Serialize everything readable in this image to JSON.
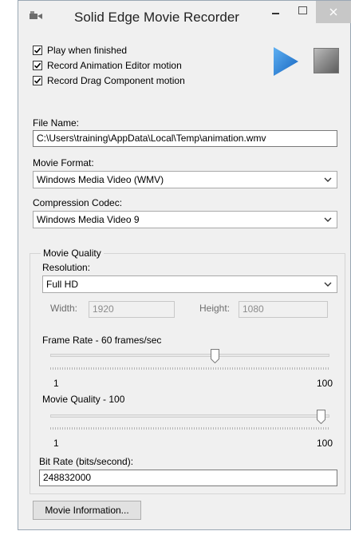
{
  "window": {
    "title": "Solid Edge Movie Recorder"
  },
  "options": {
    "play_when_finished": {
      "label": "Play when finished",
      "checked": true
    },
    "record_animation_editor": {
      "label": "Record Animation Editor motion",
      "checked": true
    },
    "record_drag_component": {
      "label": "Record Drag Component motion",
      "checked": true
    }
  },
  "file": {
    "label": "File Name:",
    "value": "C:\\Users\\training\\AppData\\Local\\Temp\\animation.wmv"
  },
  "movie_format": {
    "label": "Movie Format:",
    "selected": "Windows Media Video (WMV)"
  },
  "codec": {
    "label": "Compression Codec:",
    "selected": "Windows Media Video 9"
  },
  "quality_group": {
    "title": "Movie Quality",
    "resolution_label": "Resolution:",
    "resolution_selected": "Full HD",
    "width_label": "Width:",
    "width_value": "1920",
    "height_label": "Height:",
    "height_value": "1080",
    "frame_rate": {
      "label": "Frame Rate - 60 frames/sec",
      "min_label": "1",
      "max_label": "100",
      "min": 1,
      "max": 100,
      "value": 60
    },
    "movie_quality": {
      "label": "Movie Quality - 100",
      "min_label": "1",
      "max_label": "100",
      "min": 1,
      "max": 100,
      "value": 100
    }
  },
  "bit_rate": {
    "label": "Bit Rate (bits/second):",
    "value": "248832000"
  },
  "actions": {
    "movie_information": "Movie Information..."
  },
  "icons": {
    "app": "camera-icon",
    "play": "play-icon",
    "stop": "stop-icon"
  },
  "colors": {
    "play_blue": "#1e7fd8",
    "window_bg": "#f0f0f0",
    "close_button_bg": "#c7c7c7"
  }
}
